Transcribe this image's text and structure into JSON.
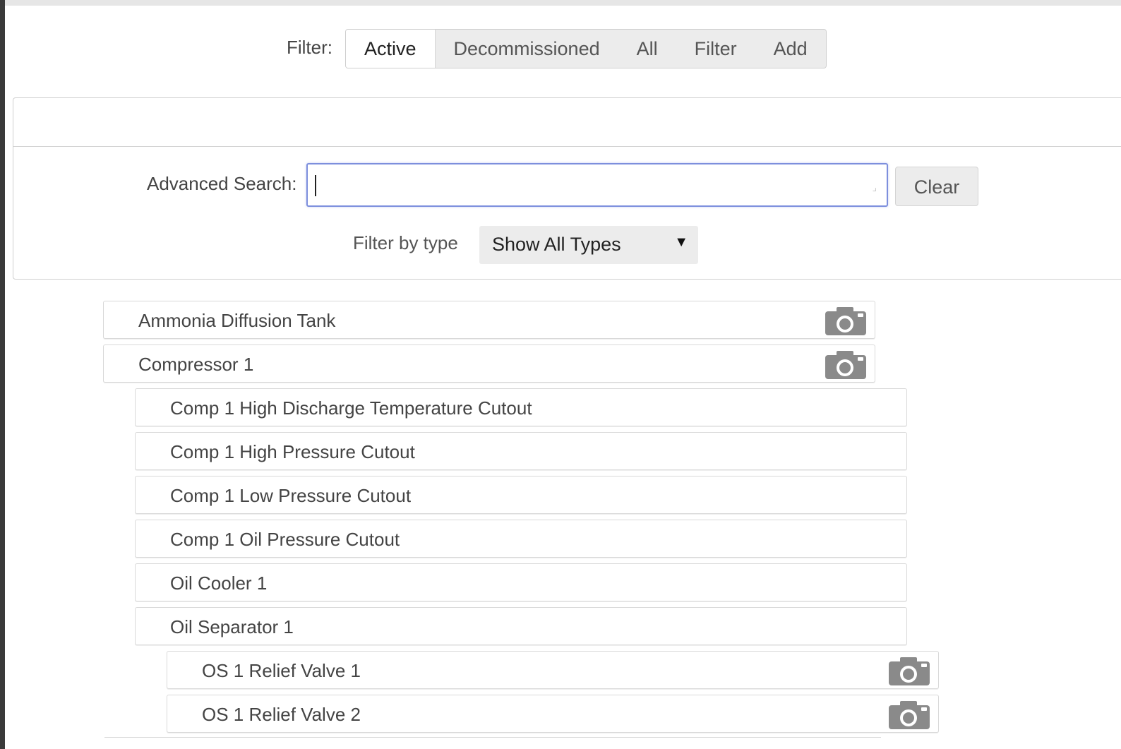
{
  "filter_bar": {
    "label": "Filter:",
    "buttons": [
      {
        "label": "Active",
        "active": true
      },
      {
        "label": "Decommissioned",
        "active": false
      },
      {
        "label": "All",
        "active": false
      },
      {
        "label": "Filter",
        "active": false
      },
      {
        "label": "Add",
        "active": false
      }
    ]
  },
  "search_panel": {
    "advanced_search_label": "Advanced Search:",
    "search_value": "",
    "clear_label": "Clear",
    "filter_type_label": "Filter by type",
    "type_select_value": "Show All Types"
  },
  "equipment_list": [
    {
      "label": "Ammonia Diffusion Tank",
      "level": 0,
      "has_camera": true
    },
    {
      "label": "Compressor 1",
      "level": 0,
      "has_camera": true
    },
    {
      "label": "Comp 1 High Discharge Temperature Cutout",
      "level": 1,
      "has_camera": false
    },
    {
      "label": "Comp 1 High Pressure Cutout",
      "level": 1,
      "has_camera": false
    },
    {
      "label": "Comp 1 Low Pressure Cutout",
      "level": 1,
      "has_camera": false
    },
    {
      "label": "Comp 1 Oil Pressure Cutout",
      "level": 1,
      "has_camera": false
    },
    {
      "label": "Oil Cooler 1",
      "level": 1,
      "has_camera": false
    },
    {
      "label": "Oil Separator 1",
      "level": 1,
      "has_camera": false
    },
    {
      "label": "OS 1 Relief Valve 1",
      "level": 2,
      "has_camera": true
    },
    {
      "label": "OS 1 Relief Valve 2",
      "level": 2,
      "has_camera": true
    }
  ],
  "icons": {
    "camera": "camera-icon",
    "select_arrow": "dropdown-arrow-icon"
  },
  "colors": {
    "focus_border": "#7d8fdd",
    "button_bg": "#ececec",
    "icon_gray": "#888888"
  }
}
